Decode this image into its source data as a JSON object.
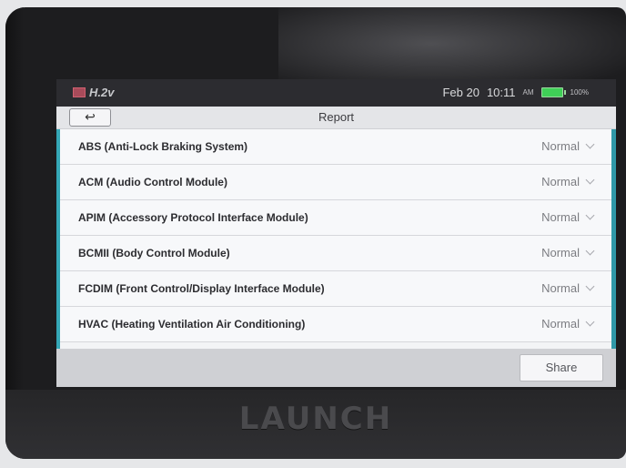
{
  "status_bar": {
    "version": "H.2v",
    "date": "Feb 20",
    "time": "10:11",
    "ampm": "AM",
    "battery": "100%",
    "battery_level": 1.0
  },
  "header": {
    "back_glyph": "↩",
    "title": "Report"
  },
  "modules": [
    {
      "label": "ABS (Anti-Lock Braking System)",
      "status": "Normal"
    },
    {
      "label": "ACM (Audio Control Module)",
      "status": "Normal"
    },
    {
      "label": "APIM (Accessory Protocol Interface Module)",
      "status": "Normal"
    },
    {
      "label": "BCMII (Body Control Module)",
      "status": "Normal"
    },
    {
      "label": "FCDIM (Front Control/Display Interface Module)",
      "status": "Normal"
    },
    {
      "label": "HVAC (Heating Ventilation Air Conditioning)",
      "status": "Normal"
    }
  ],
  "footer": {
    "share_label": "Share"
  },
  "device": {
    "brand": "LAUNCH"
  },
  "colors": {
    "accent": "#35a7b6",
    "battery": "#3fcf57"
  }
}
